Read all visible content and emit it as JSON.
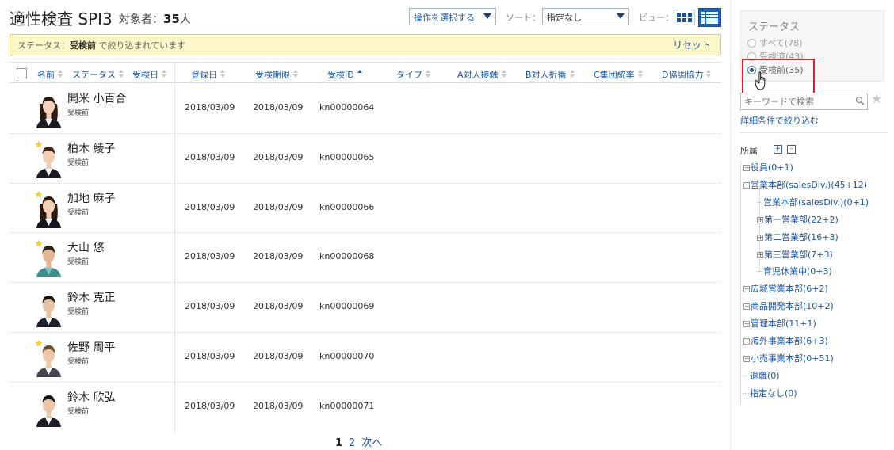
{
  "header": {
    "title": "適性検査 SPI3",
    "target_label": "対象者：",
    "target_count": "35",
    "target_unit": "人",
    "action_select": "操作を選択する",
    "sort_label": "ソート：",
    "sort_select": "指定なし",
    "view_label": "ビュー："
  },
  "filter": {
    "prefix": "ステータス：",
    "value": "受検前",
    "suffix": " で絞り込まれています",
    "reset": "リセット"
  },
  "columns": {
    "name": "名前",
    "status": "ステータス",
    "exam_date": "受検日",
    "reg_date": "登録日",
    "deadline": "受検期限",
    "exam_id": "受検ID",
    "type": "タイプ",
    "a": "A対人接触",
    "b": "B対人折衝",
    "c": "C集団統率",
    "d": "D協調協力"
  },
  "rows": [
    {
      "name": "開米 小百合",
      "status": "受検前",
      "reg_date": "2018/03/09",
      "deadline": "2018/03/09",
      "id": "kn00000064",
      "star": false
    },
    {
      "name": "柏木 綾子",
      "status": "受検前",
      "reg_date": "2018/03/09",
      "deadline": "2018/03/09",
      "id": "kn00000065",
      "star": true
    },
    {
      "name": "加地 麻子",
      "status": "受検前",
      "reg_date": "2018/03/09",
      "deadline": "2018/03/09",
      "id": "kn00000066",
      "star": true
    },
    {
      "name": "大山 悠",
      "status": "受検前",
      "reg_date": "2018/03/09",
      "deadline": "2018/03/09",
      "id": "kn00000068",
      "star": true
    },
    {
      "name": "鈴木 克正",
      "status": "受検前",
      "reg_date": "2018/03/09",
      "deadline": "2018/03/09",
      "id": "kn00000069",
      "star": false
    },
    {
      "name": "佐野 周平",
      "status": "受検前",
      "reg_date": "2018/03/09",
      "deadline": "2018/03/09",
      "id": "kn00000070",
      "star": true
    },
    {
      "name": "鈴木 欣弘",
      "status": "受検前",
      "reg_date": "2018/03/09",
      "deadline": "2018/03/09",
      "id": "kn00000071",
      "star": false
    }
  ],
  "pagination": {
    "current": "1",
    "next_page": "2",
    "next": "次へ"
  },
  "sidebar": {
    "status_title": "ステータス",
    "options": [
      {
        "label": "すべて(78)",
        "selected": false
      },
      {
        "label": "受検済(43)",
        "selected": false
      },
      {
        "label": "受検前(35)",
        "selected": true
      }
    ],
    "keyword_placeholder": "キーワードで検索",
    "advanced": "詳細条件で絞り込む",
    "dept_title": "所属",
    "tree": [
      {
        "label": "役員(0+1)",
        "level": 0,
        "toggle": "+"
      },
      {
        "label": "営業本部(salesDiv.)(45+12)",
        "level": 0,
        "toggle": "-"
      },
      {
        "label": "営業本部(salesDiv.)(0+1)",
        "level": 1,
        "toggle": ""
      },
      {
        "label": "第一営業部(22+2)",
        "level": 1,
        "toggle": "+"
      },
      {
        "label": "第二営業部(16+3)",
        "level": 1,
        "toggle": "+"
      },
      {
        "label": "第三営業部(7+3)",
        "level": 1,
        "toggle": "+"
      },
      {
        "label": "育児休業中(0+3)",
        "level": 1,
        "toggle": ""
      },
      {
        "label": "広域営業本部(6+2)",
        "level": 0,
        "toggle": "+"
      },
      {
        "label": "商品開発本部(10+2)",
        "level": 0,
        "toggle": "+"
      },
      {
        "label": "管理本部(11+1)",
        "level": 0,
        "toggle": "+"
      },
      {
        "label": "海外事業本部(6+3)",
        "level": 0,
        "toggle": "+"
      },
      {
        "label": "小売事業本部(0+51)",
        "level": 0,
        "toggle": "+"
      },
      {
        "label": "退職(0)",
        "level": 0,
        "toggle": ""
      },
      {
        "label": "指定なし(0)",
        "level": 0,
        "toggle": ""
      }
    ]
  },
  "colors": {
    "link": "#1a56a8",
    "banner_bg": "#fcf6c8",
    "highlight": "#e0202c",
    "star": "#ffd21a"
  }
}
